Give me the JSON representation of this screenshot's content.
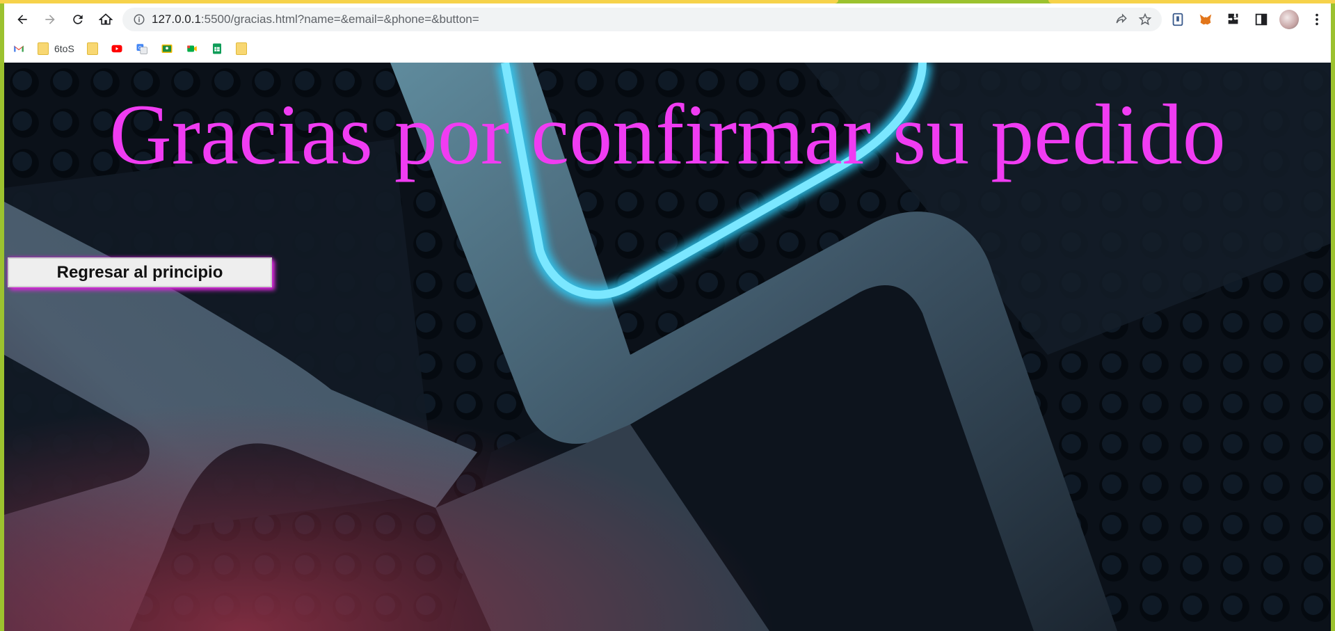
{
  "browser": {
    "url": "127.0.0.1:5500/gracias.html?name=&email=&phone=&button=",
    "url_host": "127.0.0.1",
    "url_rest": ":5500/gracias.html?name=&email=&phone=&button=",
    "nav": {
      "back_icon": "back-arrow-icon",
      "forward_icon": "forward-arrow-icon",
      "reload_icon": "reload-icon",
      "home_icon": "home-icon"
    },
    "bookmarks": [
      {
        "icon": "gmail-icon",
        "label": ""
      },
      {
        "icon": "folder-icon",
        "label": "6toS"
      },
      {
        "icon": "folder-icon",
        "label": ""
      },
      {
        "icon": "youtube-icon",
        "label": ""
      },
      {
        "icon": "translate-icon",
        "label": ""
      },
      {
        "icon": "classroom-icon",
        "label": ""
      },
      {
        "icon": "meet-icon",
        "label": ""
      },
      {
        "icon": "sheets-icon",
        "label": ""
      },
      {
        "icon": "folder-icon",
        "label": ""
      }
    ]
  },
  "page": {
    "title": "Gracias por confirmar su pedido",
    "button_label": "Regresar al principio"
  },
  "colors": {
    "title": "#f03cf2",
    "button_glow": "#d72ad9",
    "neon": "#2fd3ff",
    "frame": "#9cc22f"
  }
}
